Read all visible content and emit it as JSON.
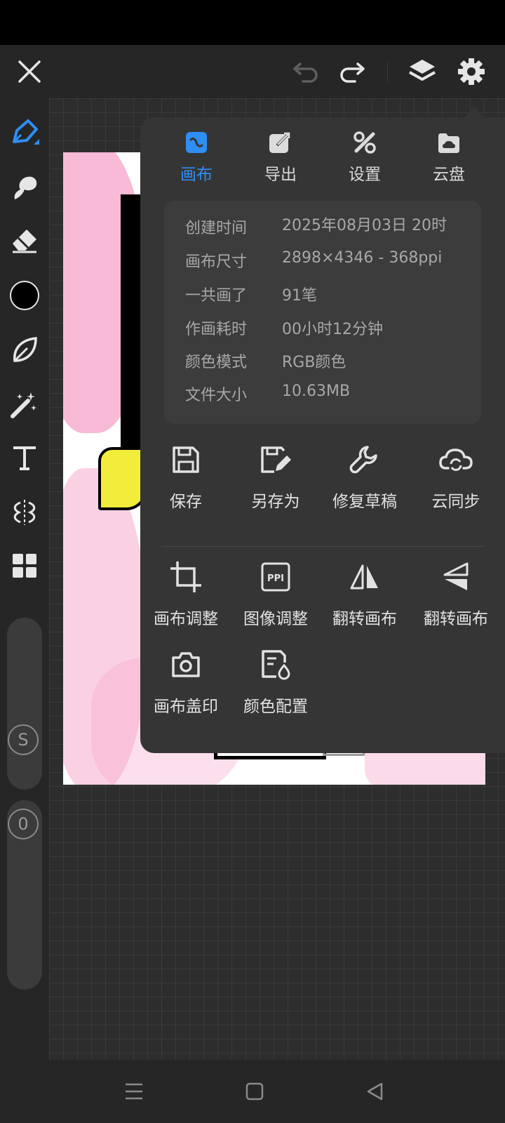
{
  "colors": {
    "accent": "#2f8ef4",
    "panel": "#353535",
    "toolbar": "#262626",
    "canvas": "#2d2d2d"
  },
  "top_bar": {
    "icons": [
      "close-icon",
      "undo-icon",
      "redo-icon",
      "layers-icon",
      "settings-gear-icon"
    ]
  },
  "left_toolbar": {
    "tools": [
      "brush-pen-icon",
      "smudge-icon",
      "eraser-icon",
      "color-swatch",
      "leaf-shape-icon",
      "magic-wand-icon",
      "text-icon",
      "symmetry-icon",
      "grid-layout-icon"
    ],
    "current_color": "#000000",
    "size_slider_label": "S",
    "opacity_slider_label": "0"
  },
  "panel": {
    "tabs": [
      {
        "label": "画布",
        "icon": "canvas-icon",
        "active": true
      },
      {
        "label": "导出",
        "icon": "export-icon",
        "active": false
      },
      {
        "label": "设置",
        "icon": "tools-icon",
        "active": false
      },
      {
        "label": "云盘",
        "icon": "cloud-drive-icon",
        "active": false
      }
    ],
    "info": [
      {
        "key": "创建时间",
        "value": "2025年08月03日 20时"
      },
      {
        "key": "画布尺寸",
        "value": "2898×4346 - 368ppi"
      },
      {
        "key": "一共画了",
        "value": "91笔"
      },
      {
        "key": "作画耗时",
        "value": "00小时12分钟"
      },
      {
        "key": "颜色模式",
        "value": "RGB颜色"
      },
      {
        "key": "文件大小",
        "value": "10.63MB"
      }
    ],
    "actions_row1": [
      {
        "label": "保存",
        "icon": "save-icon"
      },
      {
        "label": "另存为",
        "icon": "save-as-icon"
      },
      {
        "label": "修复草稿",
        "icon": "wrench-icon"
      },
      {
        "label": "云同步",
        "icon": "cloud-sync-icon"
      }
    ],
    "actions_row2": [
      {
        "label": "画布调整",
        "icon": "crop-icon"
      },
      {
        "label": "图像调整",
        "icon": "ppi-icon",
        "icon_text": "PPI"
      },
      {
        "label": "翻转画布",
        "icon": "flip-horizontal-icon"
      },
      {
        "label": "翻转画布",
        "icon": "flip-vertical-icon"
      }
    ],
    "actions_row3": [
      {
        "label": "画布盖印",
        "icon": "camera-icon"
      },
      {
        "label": "颜色配置",
        "icon": "color-profile-icon"
      }
    ]
  },
  "nav_bar": {
    "icons": [
      "menu-icon",
      "home-icon",
      "back-icon"
    ]
  }
}
